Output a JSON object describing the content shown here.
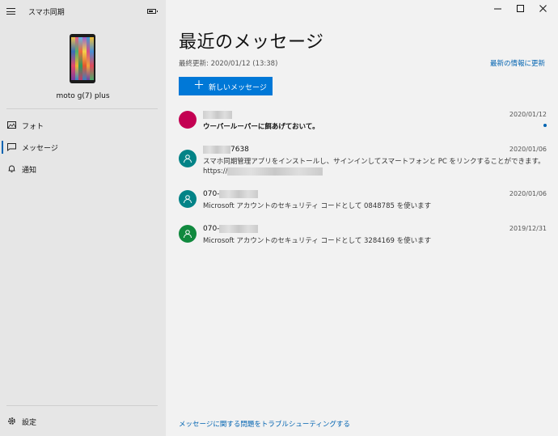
{
  "app": {
    "title": "スマホ同期"
  },
  "device": {
    "name": "moto g(7) plus"
  },
  "sidebar": {
    "items": [
      {
        "label": "フォト",
        "icon": "photo-icon"
      },
      {
        "label": "メッセージ",
        "icon": "message-icon",
        "active": true
      },
      {
        "label": "通知",
        "icon": "bell-icon"
      }
    ],
    "settings_label": "設定"
  },
  "main": {
    "title": "最近のメッセージ",
    "last_updated": "最終更新: 2020/01/12 (13:38)",
    "refresh_link": "最新の情報に更新",
    "new_message_label": "新しいメッセージ",
    "troubleshoot_link": "メッセージに関する問題をトラブルシューティングする"
  },
  "conversations": [
    {
      "sender_visible": "",
      "preview": "ウーパールーパーに餌あげておいて。",
      "date": "2020/01/12",
      "unread": true,
      "avatar_color": "#c30052"
    },
    {
      "sender_visible": "7638",
      "preview": "スマホ同期管理アプリをインストールし、サインインしてスマートフォンと PC をリンクすることができます。",
      "preview2": "https://",
      "date": "2020/01/06",
      "avatar_color": "#038387"
    },
    {
      "sender_visible": "070-",
      "preview": "Microsoft アカウントのセキュリティ コードとして 0848785 を使います",
      "date": "2020/01/06",
      "avatar_color": "#038387"
    },
    {
      "sender_visible": "070-",
      "preview": "Microsoft アカウントのセキュリティ コードとして 3284169 を使います",
      "date": "2019/12/31",
      "avatar_color": "#10893e"
    }
  ],
  "colors": {
    "accent": "#0078d7",
    "link": "#0063b1",
    "sidebar_bg": "#e6e6e6",
    "main_bg": "#f2f2f2"
  }
}
